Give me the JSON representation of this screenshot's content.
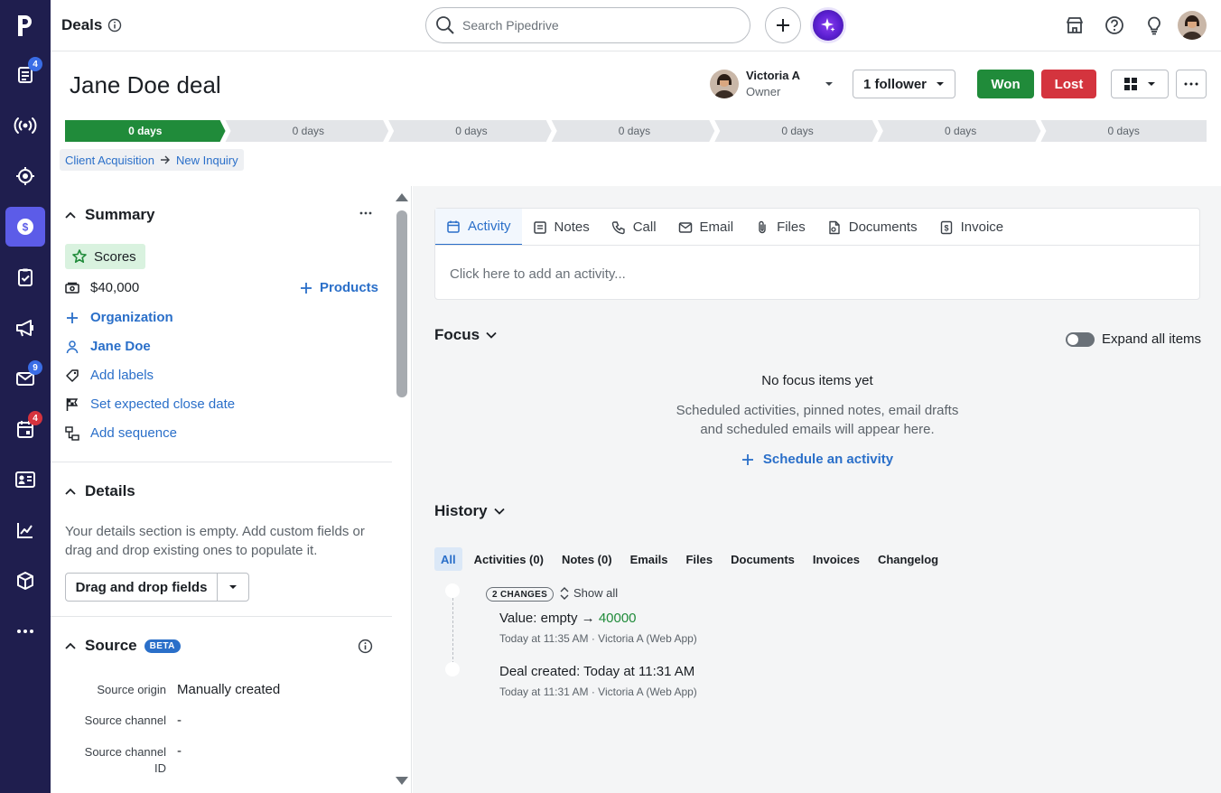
{
  "nav": {
    "badges": {
      "activities": "4",
      "mail": "9",
      "calendar": "4"
    },
    "icons": [
      "pipedrive-logo",
      "activities-icon",
      "broadcast-icon",
      "target-icon",
      "deals-icon",
      "tasks-icon",
      "campaigns-icon",
      "mail-icon",
      "calendar-icon",
      "contacts-icon",
      "insights-icon",
      "products-icon",
      "more-icon"
    ]
  },
  "topbar": {
    "title": "Deals",
    "search_placeholder": "Search Pipedrive"
  },
  "deal": {
    "title": "Jane Doe deal",
    "owner_name": "Victoria A",
    "owner_role": "Owner",
    "followers": "1 follower",
    "won": "Won",
    "lost": "Lost"
  },
  "pipeline": {
    "stages": [
      "0 days",
      "0 days",
      "0 days",
      "0 days",
      "0 days",
      "0 days",
      "0 days"
    ],
    "active_index": 0,
    "breadcrumb_pipeline": "Client Acquisition",
    "breadcrumb_stage": "New Inquiry"
  },
  "summary": {
    "title": "Summary",
    "scores": "Scores",
    "value": "$40,000",
    "products": "Products",
    "organization": "Organization",
    "person": "Jane Doe",
    "add_labels": "Add labels",
    "close_date": "Set expected close date",
    "sequence": "Add sequence"
  },
  "details": {
    "title": "Details",
    "empty_text_1": "Your details section is empty. Add custom fields or",
    "empty_text_2": "drag and drop existing ones to populate it.",
    "drag_button": "Drag and drop fields"
  },
  "source": {
    "title": "Source",
    "beta": "BETA",
    "origin_label": "Source origin",
    "origin_value": "Manually created",
    "channel_label": "Source channel",
    "channel_value": "-",
    "channel_id_label_1": "Source channel",
    "channel_id_label_2": "ID",
    "channel_id_value": "-"
  },
  "composer": {
    "tabs": [
      "Activity",
      "Notes",
      "Call",
      "Email",
      "Files",
      "Documents",
      "Invoice"
    ],
    "active_tab": "Activity",
    "prompt": "Click here to add an activity..."
  },
  "focus": {
    "title": "Focus",
    "expand_all": "Expand all items",
    "empty_title": "No focus items yet",
    "empty_line_1": "Scheduled activities, pinned notes, email drafts",
    "empty_line_2": "and scheduled emails will appear here.",
    "schedule": "Schedule an activity"
  },
  "history": {
    "title": "History",
    "filters": [
      "All",
      "Activities (0)",
      "Notes (0)",
      "Emails",
      "Files",
      "Documents",
      "Invoices",
      "Changelog"
    ],
    "active_filter": "All",
    "changes_chip": "2 CHANGES",
    "show_all": "Show all",
    "entry1_field": "Value",
    "entry1_from": "empty",
    "entry1_to": "40000",
    "entry1_meta": "Today at 11:35 AM · Victoria A (Web App)",
    "entry2_label": "Deal created",
    "entry2_value": "Today at 11:31 AM",
    "entry2_meta": "Today at 11:31 AM · Victoria A (Web App)"
  },
  "colors": {
    "nav_bg": "#1f1e4e",
    "nav_active": "#5c5ce8",
    "won": "#208b3a",
    "lost": "#d4343e",
    "link": "#2a6fc9",
    "stage_active": "#208b3a",
    "stage_inactive": "#e3e5e8"
  }
}
